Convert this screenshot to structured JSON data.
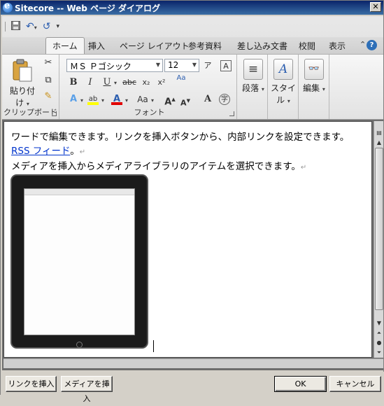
{
  "window": {
    "title": "Sitecore -- Web ページ ダイアログ",
    "close_glyph": "✕"
  },
  "quick_access": {
    "save_icon": "save-icon",
    "undo_icon": "undo-icon",
    "redo_icon": "redo-icon"
  },
  "ribbon": {
    "tabs": [
      "ホーム",
      "挿入",
      "ページ レイアウト",
      "参考資料",
      "差し込み文書",
      "校閲",
      "表示"
    ],
    "active_tab": "ホーム",
    "groups": {
      "clipboard": {
        "label": "クリップボード",
        "paste_label": "貼り付け"
      },
      "font": {
        "label": "フォント",
        "font_name": "ＭＳ Ｐゴシック",
        "font_size": "12"
      },
      "paragraph": {
        "label": "段落"
      },
      "style": {
        "label": "スタイル"
      },
      "edit": {
        "label": "編集"
      }
    }
  },
  "document": {
    "line1": "ワードで編集できます。リンクを挿入ボタンから、内部リンクを設定できます。",
    "link_text": "RSS フィード",
    "line2_suffix": "。",
    "line3": "メディアを挿入からメディアライブラリのアイテムを選択できます。",
    "para_mark": "↵"
  },
  "footer": {
    "insert_link_label": "リンクを挿入",
    "insert_media_label": "メディアを挿入",
    "ok_label": "OK",
    "cancel_label": "キャンセル"
  }
}
